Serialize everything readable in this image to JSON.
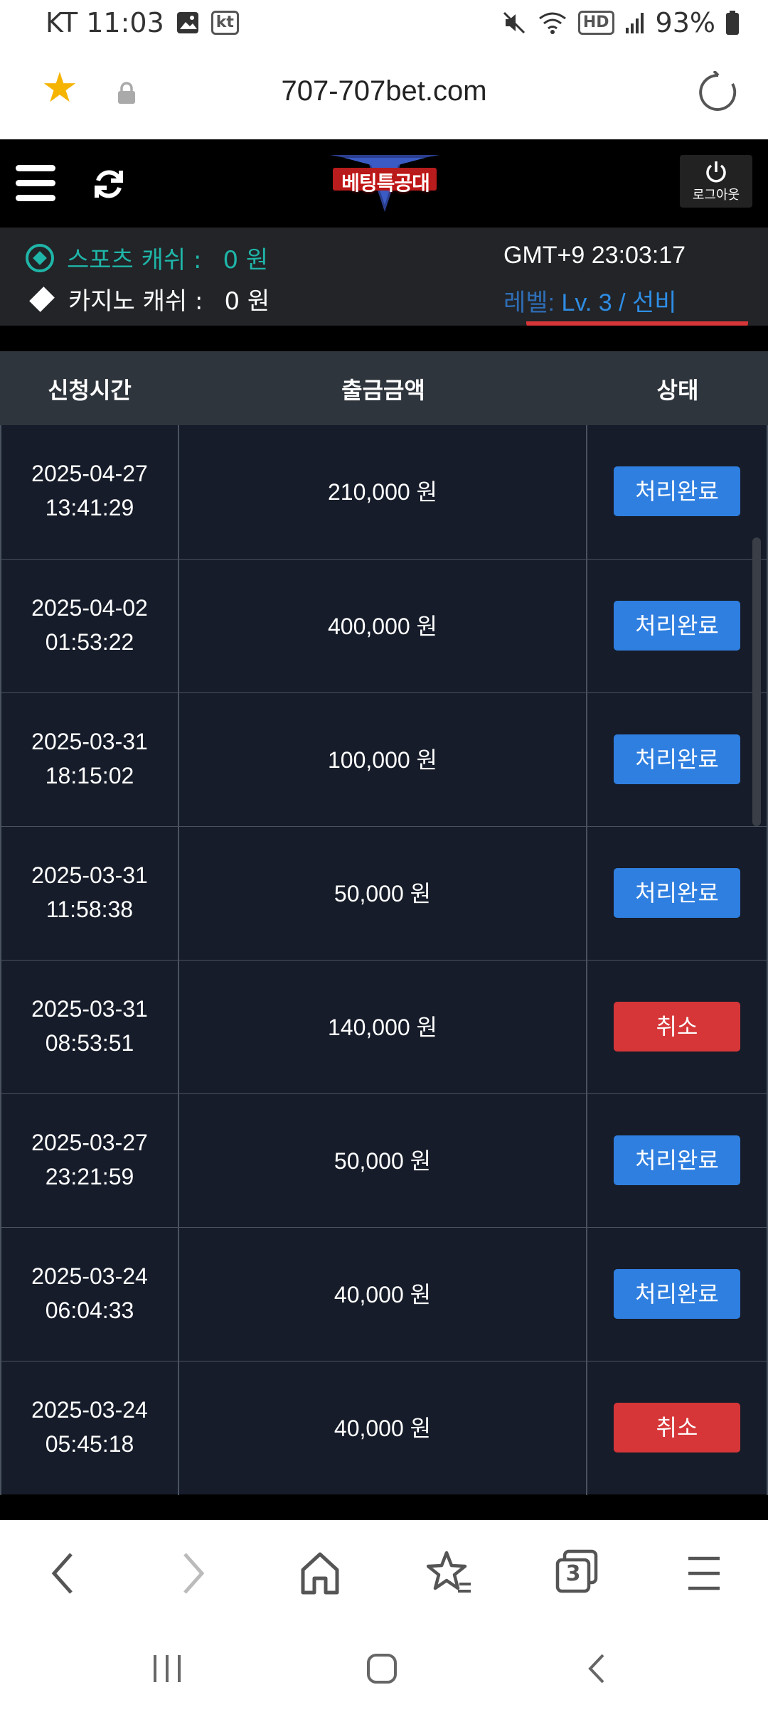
{
  "status_bar": {
    "carrier_time": "KT 11:03",
    "kt_badge": "kt",
    "hd_badge": "HD",
    "battery": "93%",
    "icons": [
      "image-icon",
      "mute-icon",
      "wifi-icon",
      "signal-icon",
      "battery-icon"
    ]
  },
  "browser": {
    "url": "707-707bet.com",
    "icons": [
      "favorite-star-icon",
      "lock-icon",
      "reload-icon"
    ]
  },
  "header": {
    "logo_text": "베팅특공대",
    "logout_label": "로그아웃",
    "icons": [
      "menu-icon",
      "refresh-icon",
      "power-icon"
    ]
  },
  "info": {
    "sports_label": "스포츠 캐쉬 :",
    "sports_value": "0 원",
    "casino_label": "카지노 캐쉬 :",
    "casino_value": "0 원",
    "gmt": "GMT+9 23:03:17",
    "level_label": "레벨:",
    "level_value": "Lv. 3 / 선비"
  },
  "table": {
    "headers": [
      "신청시간",
      "출금금액",
      "상태"
    ],
    "rows": [
      {
        "date": "2025-04-27",
        "time": "13:41:29",
        "amount": "210,000 원",
        "status": "처리완료",
        "kind": "done"
      },
      {
        "date": "2025-04-02",
        "time": "01:53:22",
        "amount": "400,000 원",
        "status": "처리완료",
        "kind": "done"
      },
      {
        "date": "2025-03-31",
        "time": "18:15:02",
        "amount": "100,000 원",
        "status": "처리완료",
        "kind": "done"
      },
      {
        "date": "2025-03-31",
        "time": "11:58:38",
        "amount": "50,000 원",
        "status": "처리완료",
        "kind": "done"
      },
      {
        "date": "2025-03-31",
        "time": "08:53:51",
        "amount": "140,000 원",
        "status": "취소",
        "kind": "cancel"
      },
      {
        "date": "2025-03-27",
        "time": "23:21:59",
        "amount": "50,000 원",
        "status": "처리완료",
        "kind": "done"
      },
      {
        "date": "2025-03-24",
        "time": "06:04:33",
        "amount": "40,000 원",
        "status": "처리완료",
        "kind": "done"
      },
      {
        "date": "2025-03-24",
        "time": "05:45:18",
        "amount": "40,000 원",
        "status": "취소",
        "kind": "cancel"
      }
    ]
  },
  "bottom_nav": {
    "tab_count": "3",
    "icons": [
      "back-icon",
      "forward-icon",
      "home-icon",
      "bookmarks-icon",
      "tabs-icon",
      "menu-icon"
    ]
  },
  "system_nav": {
    "icons": [
      "recents-icon",
      "home-button-icon",
      "system-back-icon"
    ]
  },
  "colors": {
    "accent_teal": "#1fb5a8",
    "done": "#2f7fe0",
    "cancel": "#d63638",
    "row_bg": "#161c29",
    "header_bg": "#2f353c"
  }
}
